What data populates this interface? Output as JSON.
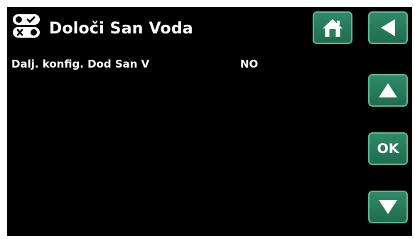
{
  "header": {
    "title": "Določi San Voda",
    "icon": "settings-toggles-icon"
  },
  "setting": {
    "label": "Dalj. konfig. Dod San V",
    "value": "NO"
  },
  "nav": {
    "home_icon": "home-icon",
    "back_icon": "back-arrow-icon",
    "up_icon": "up-arrow-icon",
    "ok_label": "OK",
    "down_icon": "down-arrow-icon"
  },
  "colors": {
    "background": "#000000",
    "button_fill": "#2a7f5f",
    "button_border": "#5fb595",
    "text": "#ffffff"
  }
}
